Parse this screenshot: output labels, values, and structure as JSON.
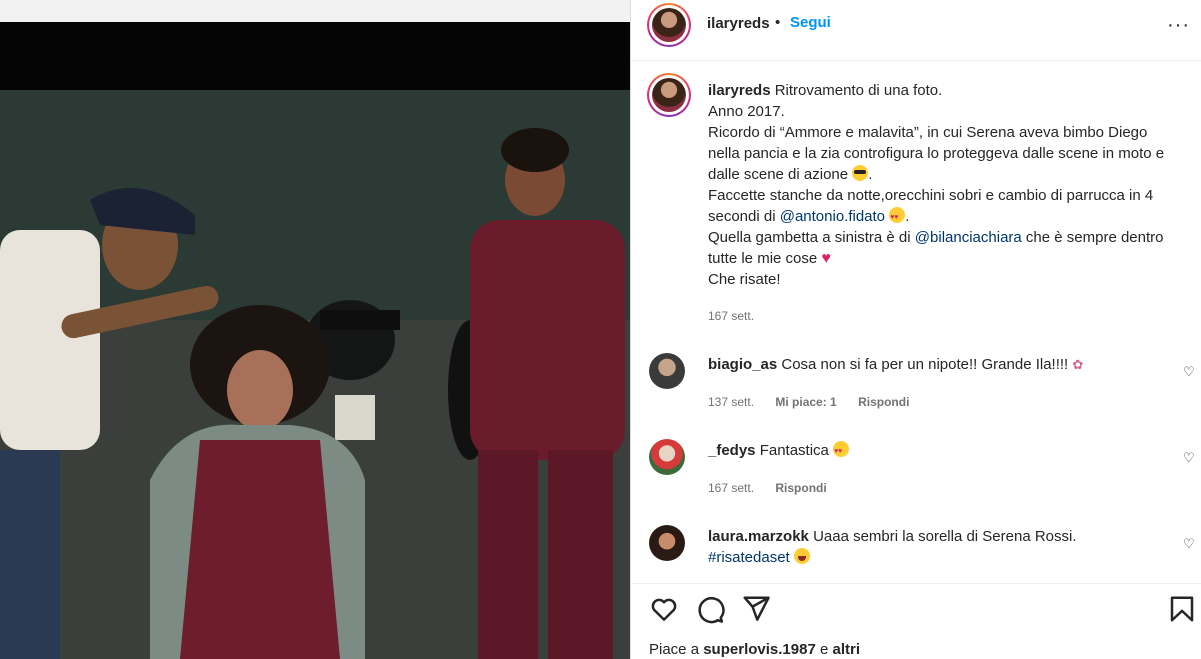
{
  "post": {
    "username": "ilaryreds",
    "follow_label": "Segui",
    "dot": "•",
    "more": "···"
  },
  "caption": {
    "username": "ilaryreds",
    "line1": "Ritrovamento di una foto.",
    "line2": "Anno 2017.",
    "line3": "Ricordo di “Ammore e malavita”, in cui Serena aveva bimbo Diego nella pancia e la zia controfigura lo proteggeva dalle scene in moto e dalle scene di azione",
    "line4a": "Faccette stanche da notte,orecchini sobri e cambio di parrucca in 4 secondi di",
    "mention1": "@antonio.fidato",
    "line5a": "Quella gambetta a sinistra è di",
    "mention2": "@bilanciachiara",
    "line5b": "che è sempre dentro tutte le mie cose",
    "line6": "Che risate!",
    "time": "167 sett."
  },
  "comments": [
    {
      "username": "biagio_as",
      "text": "Cosa non si fa per un nipote!! Grande Ila!!!!",
      "time": "137 sett.",
      "likes": "Mi piace: 1",
      "reply": "Rispondi"
    },
    {
      "username": "_fedys",
      "text": "Fantastica",
      "time": "167 sett.",
      "reply": "Rispondi"
    },
    {
      "username": "laura.marzokk",
      "text": "Uaaa sembri la sorella di Serena Rossi.",
      "tag": "#risatedaset"
    }
  ],
  "likes_line": {
    "prefix": "Piace a",
    "user": "superlovis.1987",
    "and": "e",
    "others": "altri"
  },
  "icons": [
    "heart-icon",
    "comment-icon",
    "share-icon",
    "bookmark-icon",
    "more-icon"
  ],
  "colors": {
    "accent": "#0095f6",
    "mention": "#00376b",
    "muted": "#737373",
    "text": "#262626"
  }
}
